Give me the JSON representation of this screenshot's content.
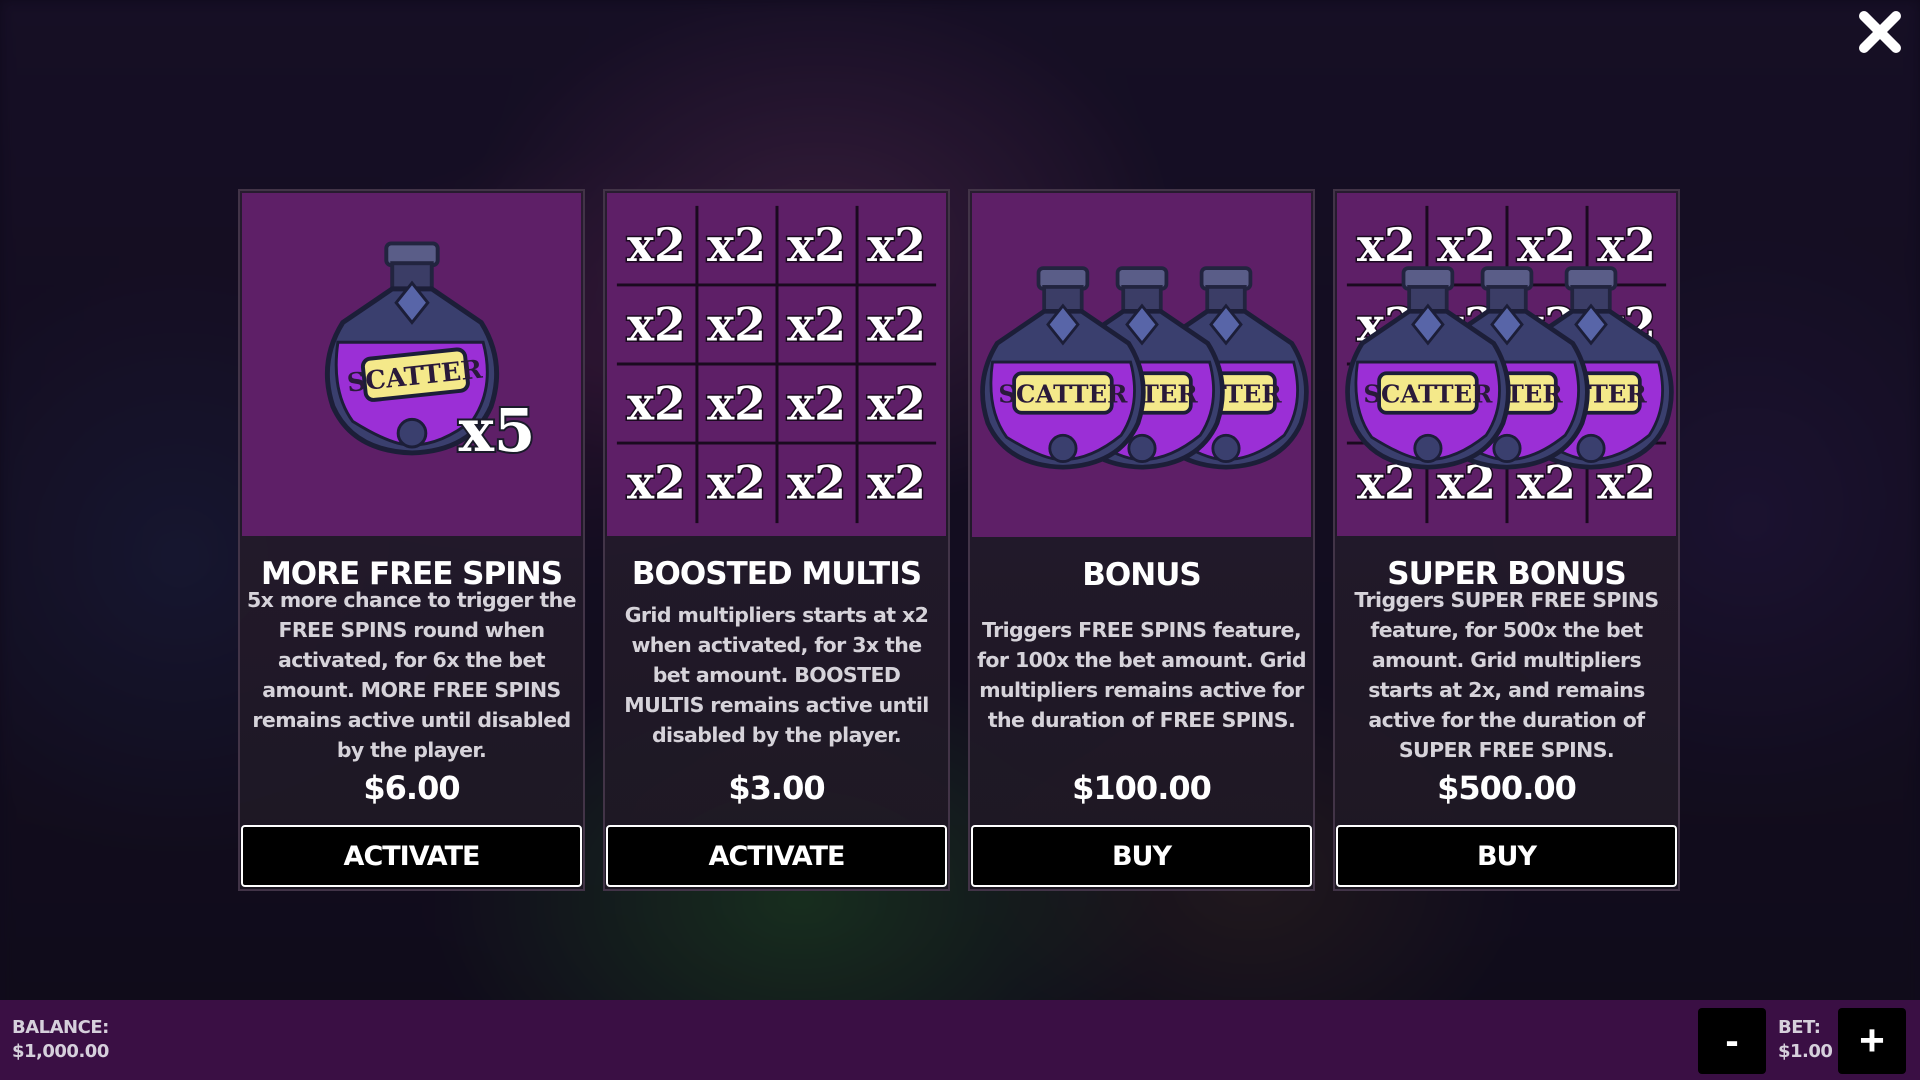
{
  "close": {
    "icon": "close-icon"
  },
  "cards": [
    {
      "title": "MORE FREE SPINS",
      "description": "5x more chance to trigger the FREE SPINS round when activated, for 6x the bet amount. MORE FREE SPINS remains active until disabled by the player.",
      "price": "$6.00",
      "button": "ACTIVATE",
      "image": {
        "type": "scatter-potion",
        "badge": "x5",
        "label": "SCATTER"
      }
    },
    {
      "title": "BOOSTED MULTIS",
      "description": "Grid multipliers starts at x2 when activated, for 3x the bet amount. BOOSTED MULTIS remains active until disabled by the player.",
      "price": "$3.00",
      "button": "ACTIVATE",
      "image": {
        "type": "multiplier-grid",
        "cell": "x2"
      }
    },
    {
      "title": "BONUS",
      "description": "Triggers FREE SPINS feature, for 100x the bet amount. Grid multipliers remains active for the duration of FREE SPINS.",
      "price": "$100.00",
      "button": "BUY",
      "image": {
        "type": "three-scatter-potions",
        "label": "SCATTER",
        "label_partial": "CATTER"
      }
    },
    {
      "title": "SUPER BONUS",
      "description": "Triggers SUPER FREE SPINS feature, for 500x the bet amount. Grid multipliers starts at 2x, and remains active for the duration of SUPER FREE SPINS.",
      "price": "$500.00",
      "button": "BUY",
      "image": {
        "type": "potions-over-grid",
        "label": "SCATTER",
        "label_partial": "CATTER",
        "cell": "x2"
      }
    }
  ],
  "bottom": {
    "balance_label": "BALANCE:",
    "balance_value": "$1,000.00",
    "bet_label": "BET:",
    "bet_value": "$1.00",
    "minus": "-",
    "plus": "+"
  },
  "colors": {
    "card_image_bg": "#5e1f67",
    "bottom_bar": "#3a0f44",
    "potion_liquid": "#9b2fd6",
    "scatter_label": "#f4e98a"
  }
}
